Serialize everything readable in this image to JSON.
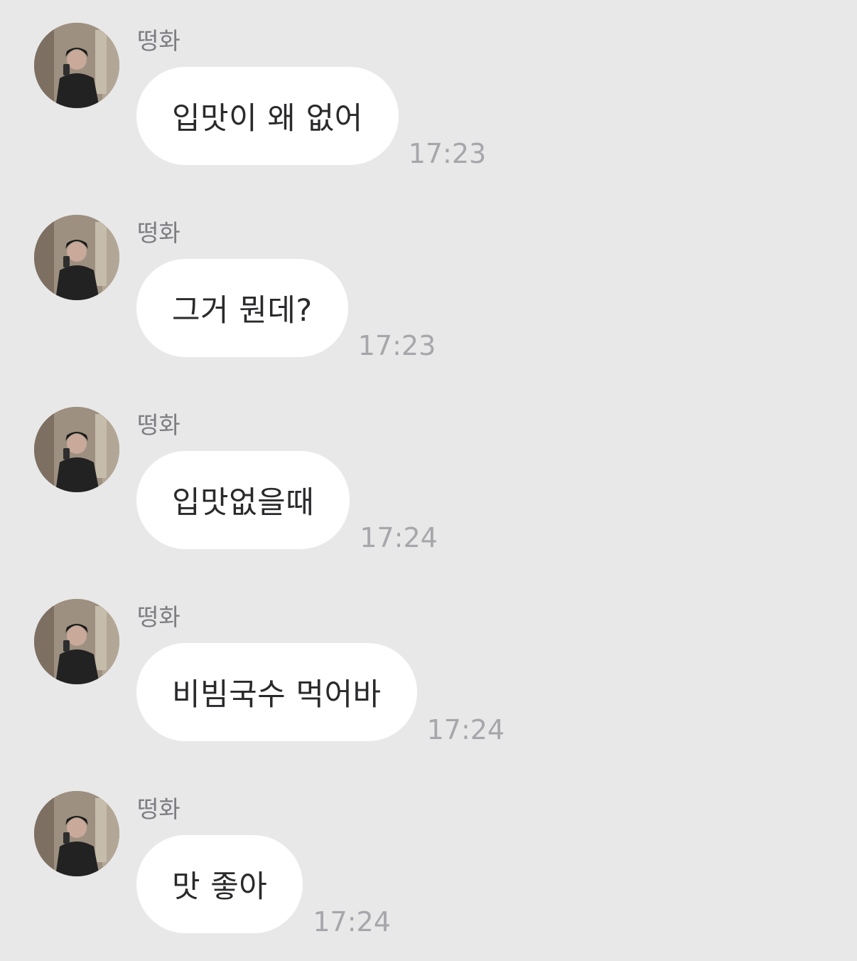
{
  "messages": [
    {
      "sender": "떵화",
      "text": "입맛이 왜 없어",
      "time": "17:23"
    },
    {
      "sender": "떵화",
      "text": "그거 뭔데?",
      "time": "17:23"
    },
    {
      "sender": "떵화",
      "text": "입맛없을때",
      "time": "17:24"
    },
    {
      "sender": "떵화",
      "text": "비빔국수 먹어바",
      "time": "17:24"
    },
    {
      "sender": "떵화",
      "text": "맛 좋아",
      "time": "17:24"
    }
  ],
  "colors": {
    "background": "#e8e8e9",
    "bubble": "#ffffff",
    "sender_text": "#7c7c81",
    "time_text": "#a6a6ab",
    "message_text": "#2a2a2c"
  },
  "icons": {
    "avatar": "profile-photo"
  }
}
